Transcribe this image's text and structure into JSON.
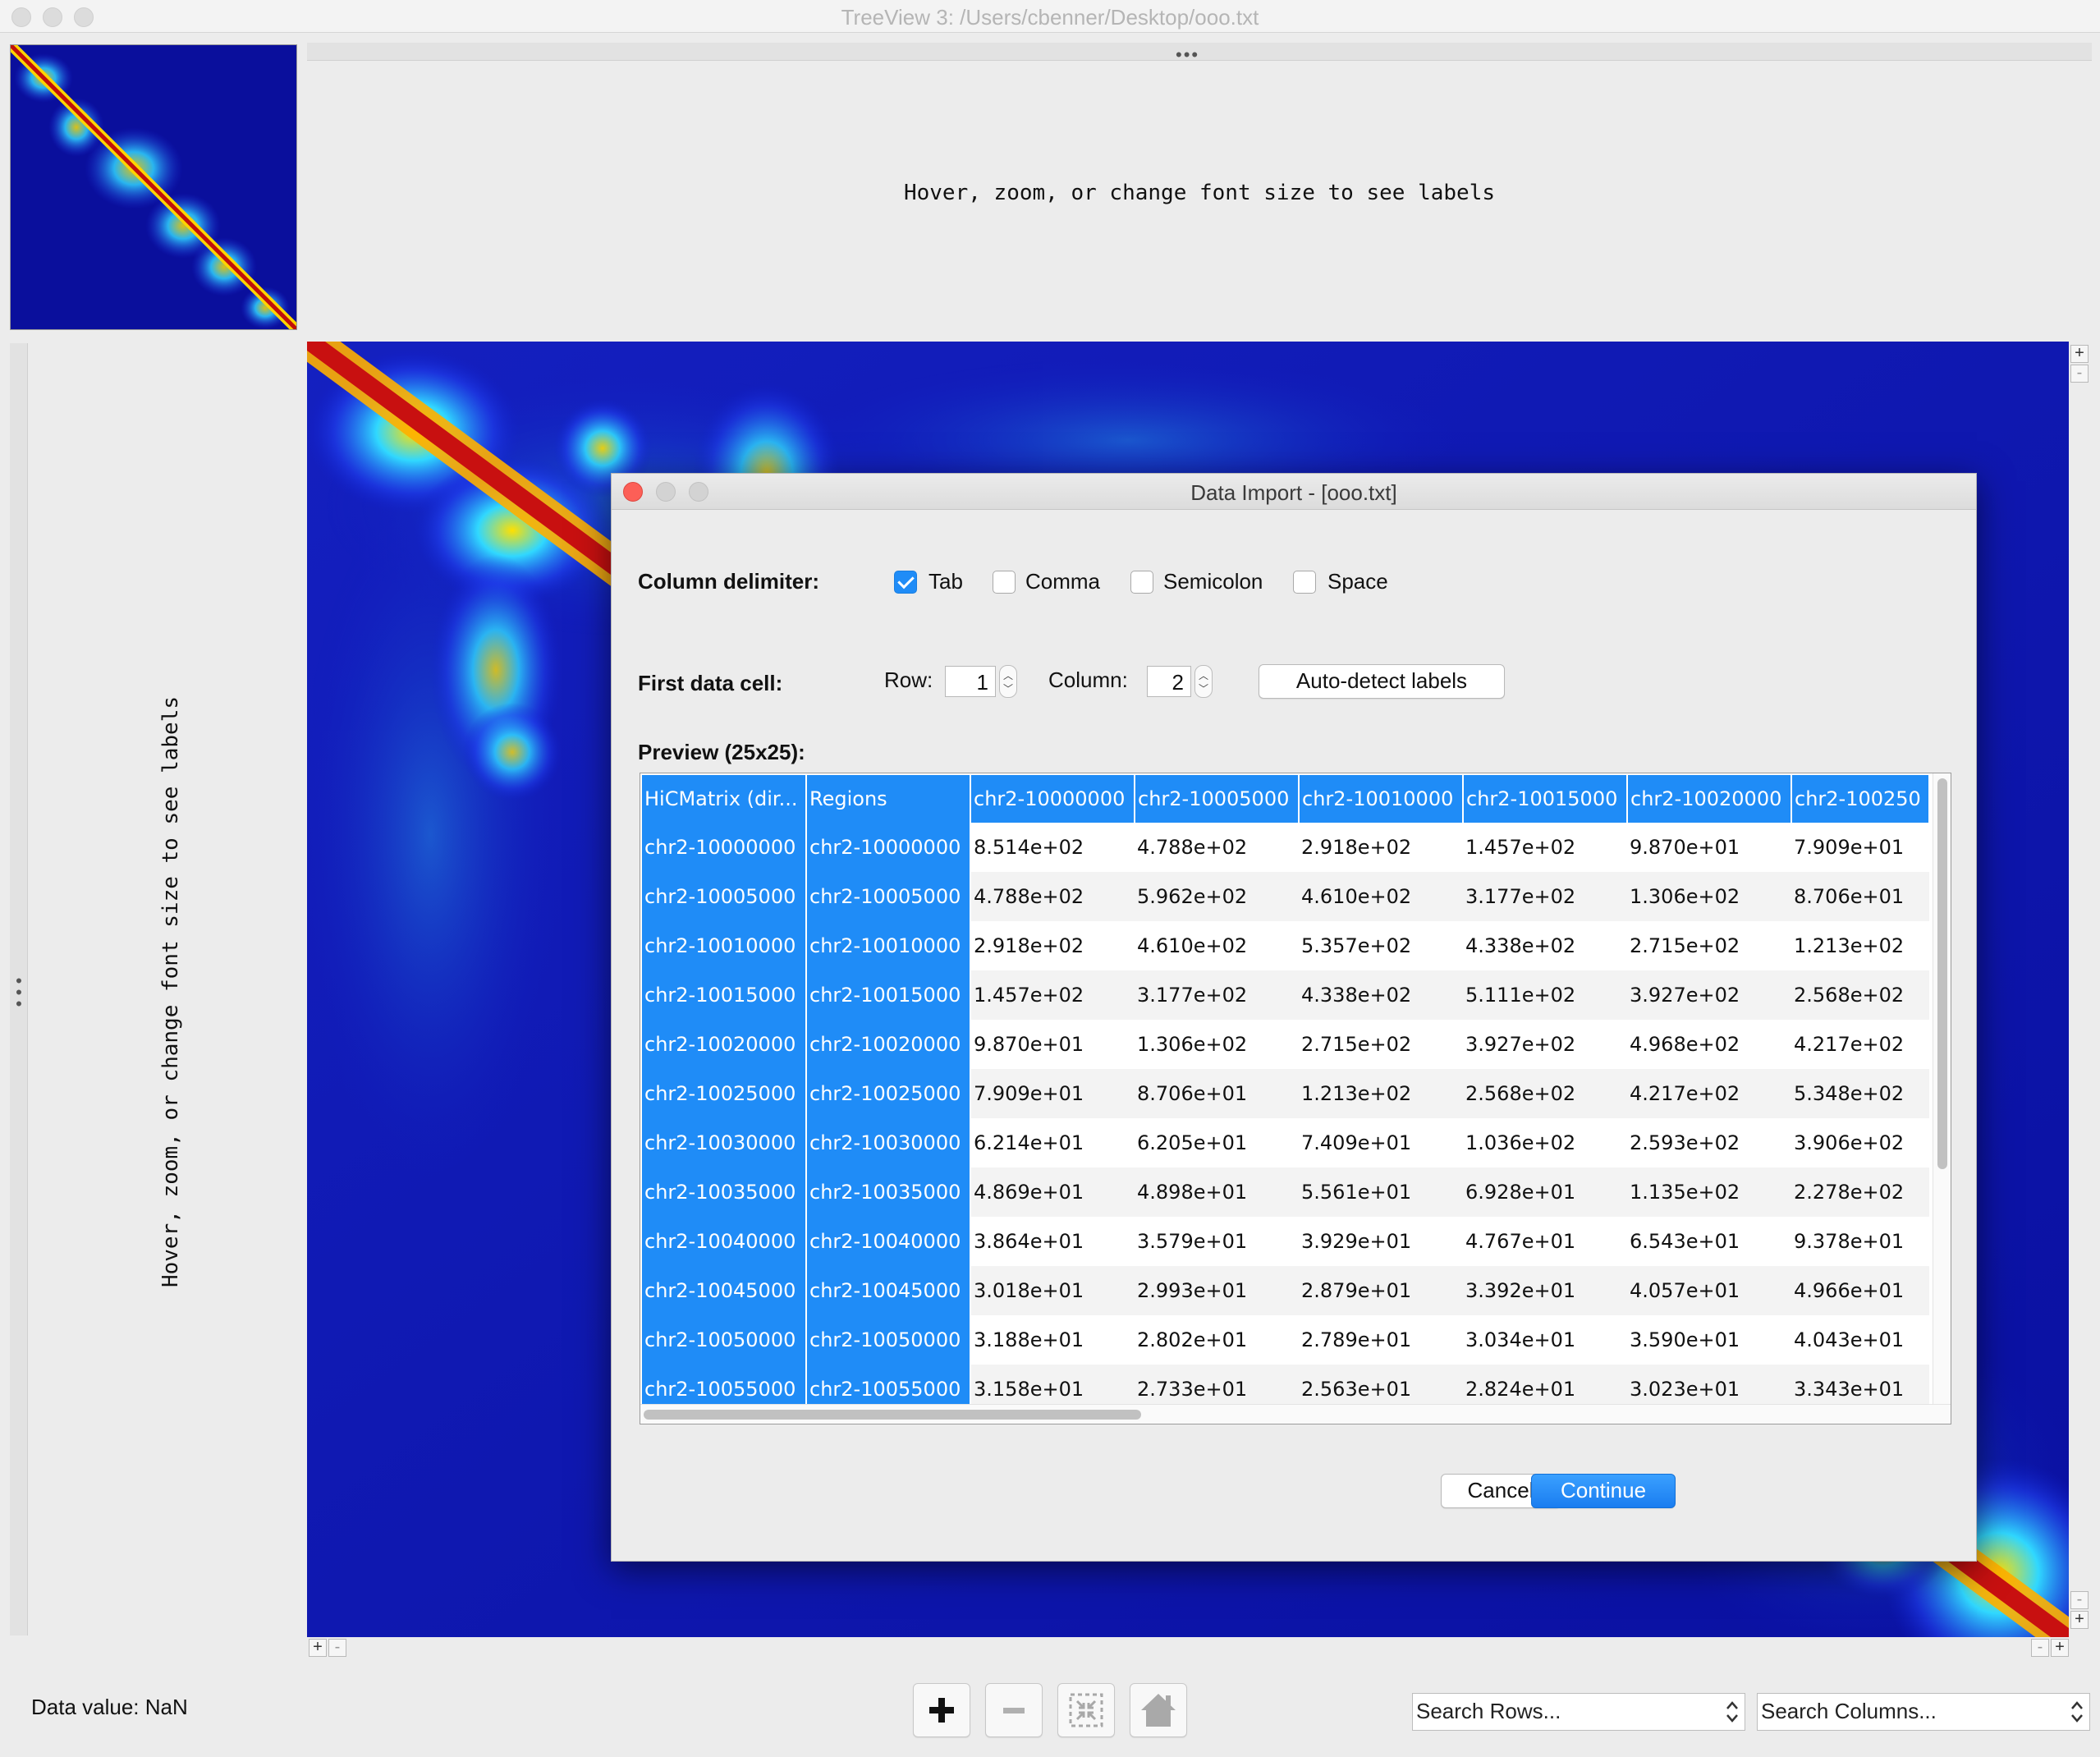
{
  "window": {
    "title": "TreeView 3: /Users/cbenner/Desktop/ooo.txt"
  },
  "labels": {
    "column_hint": "Hover, zoom, or change font size to see labels",
    "row_hint": "Hover, zoom, or change font size to see labels"
  },
  "bottom_bar": {
    "data_value": "Data value: NaN",
    "zoom_in": "+",
    "zoom_out": "−",
    "search_rows_placeholder": "Search Rows...",
    "search_columns_placeholder": "Search Columns..."
  },
  "dialog": {
    "title": "Data Import - [ooo.txt]",
    "column_delimiter_label": "Column delimiter:",
    "delimiters": [
      {
        "label": "Tab",
        "checked": true
      },
      {
        "label": "Comma",
        "checked": false
      },
      {
        "label": "Semicolon",
        "checked": false
      },
      {
        "label": "Space",
        "checked": false
      }
    ],
    "first_data_cell_label": "First data cell:",
    "row_label": "Row:",
    "row_value": "1",
    "column_label": "Column:",
    "column_value": "2",
    "auto_detect_label": "Auto-detect labels",
    "preview_label": "Preview (25x25):",
    "cancel_label": "Cancel",
    "continue_label": "Continue",
    "preview": {
      "header": [
        "HiCMatrix (dir...",
        "Regions",
        "chr2-10000000",
        "chr2-10005000",
        "chr2-10010000",
        "chr2-10015000",
        "chr2-10020000",
        "chr2-100250"
      ],
      "rows": [
        [
          "chr2-10000000",
          "chr2-10000000",
          "8.514e+02",
          "4.788e+02",
          "2.918e+02",
          "1.457e+02",
          "9.870e+01",
          "7.909e+01"
        ],
        [
          "chr2-10005000",
          "chr2-10005000",
          "4.788e+02",
          "5.962e+02",
          "4.610e+02",
          "3.177e+02",
          "1.306e+02",
          "8.706e+01"
        ],
        [
          "chr2-10010000",
          "chr2-10010000",
          "2.918e+02",
          "4.610e+02",
          "5.357e+02",
          "4.338e+02",
          "2.715e+02",
          "1.213e+02"
        ],
        [
          "chr2-10015000",
          "chr2-10015000",
          "1.457e+02",
          "3.177e+02",
          "4.338e+02",
          "5.111e+02",
          "3.927e+02",
          "2.568e+02"
        ],
        [
          "chr2-10020000",
          "chr2-10020000",
          "9.870e+01",
          "1.306e+02",
          "2.715e+02",
          "3.927e+02",
          "4.968e+02",
          "4.217e+02"
        ],
        [
          "chr2-10025000",
          "chr2-10025000",
          "7.909e+01",
          "8.706e+01",
          "1.213e+02",
          "2.568e+02",
          "4.217e+02",
          "5.348e+02"
        ],
        [
          "chr2-10030000",
          "chr2-10030000",
          "6.214e+01",
          "6.205e+01",
          "7.409e+01",
          "1.036e+02",
          "2.593e+02",
          "3.906e+02"
        ],
        [
          "chr2-10035000",
          "chr2-10035000",
          "4.869e+01",
          "4.898e+01",
          "5.561e+01",
          "6.928e+01",
          "1.135e+02",
          "2.278e+02"
        ],
        [
          "chr2-10040000",
          "chr2-10040000",
          "3.864e+01",
          "3.579e+01",
          "3.929e+01",
          "4.767e+01",
          "6.543e+01",
          "9.378e+01"
        ],
        [
          "chr2-10045000",
          "chr2-10045000",
          "3.018e+01",
          "2.993e+01",
          "2.879e+01",
          "3.392e+01",
          "4.057e+01",
          "4.966e+01"
        ],
        [
          "chr2-10050000",
          "chr2-10050000",
          "3.188e+01",
          "2.802e+01",
          "2.789e+01",
          "3.034e+01",
          "3.590e+01",
          "4.043e+01"
        ],
        [
          "chr2-10055000",
          "chr2-10055000",
          "3.158e+01",
          "2.733e+01",
          "2.563e+01",
          "2.824e+01",
          "3.023e+01",
          "3.343e+01"
        ]
      ]
    }
  },
  "colors": {
    "heatmap_low": "#0b13a8",
    "heatmap_high": "#c81010",
    "selection_blue": "#1f8cf7",
    "close_red": "#fc5f57"
  },
  "icons": [
    "zoom-in-icon",
    "zoom-out-icon",
    "fit-screen-icon",
    "home-icon",
    "stepper-icon"
  ]
}
